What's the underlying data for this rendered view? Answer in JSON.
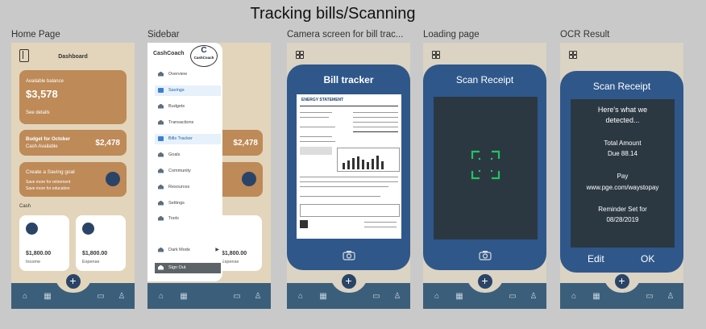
{
  "canvas_title": "Tracking bills/Scanning",
  "screen_labels": [
    "Home Page",
    "Sidebar",
    "Camera screen for bill trac...",
    "Loading page",
    "OCR Result"
  ],
  "home": {
    "title": "Dashboard",
    "balance_label": "Available balance",
    "balance_value": "$3,578",
    "see_details": "See details",
    "budget_title": "Budget for October",
    "budget_sub": "Cash Available",
    "budget_value": "$2,478",
    "saving_title": "Create a Saving goal",
    "saving_line1": "Save more for retirement",
    "saving_line2": "Save more for education",
    "cash_label": "Cash",
    "income_value": "$1,800.00",
    "income_label": "Income",
    "expense_value": "$1,800.00",
    "expense_label": "Expense"
  },
  "sidebar": {
    "brand": "CashCoach",
    "logo_text": "CashCoach",
    "items": [
      {
        "label": "Overview"
      },
      {
        "label": "Savings"
      },
      {
        "label": "Budgets"
      },
      {
        "label": "Transactions"
      },
      {
        "label": "Bills Tracker"
      },
      {
        "label": "Goals"
      },
      {
        "label": "Community"
      },
      {
        "label": "Resources"
      },
      {
        "label": "Settings"
      },
      {
        "label": "Tools"
      }
    ],
    "dark_mode": "Dark Mode",
    "sign_out": "Sign Out",
    "behind_value": "$2,478",
    "behind_expense": "$1,800.00",
    "behind_expense_label": "Expense"
  },
  "camera": {
    "header": "Bill tracker",
    "bill_title": "ENERGY STATEMENT"
  },
  "loading": {
    "header": "Scan Receipt"
  },
  "ocr": {
    "header": "Scan Receipt",
    "line1": "Here's what we",
    "line2": "detected...",
    "total_label": "Total Amount",
    "due": "Due 88.14",
    "pay": "Pay",
    "url": "www.pge.com/waystopay",
    "reminder": "Reminder Set for",
    "date": "08/28/2019",
    "edit": "Edit",
    "ok": "OK"
  },
  "colors": {
    "card_brown": "#bd8a58",
    "navy": "#2a4468",
    "phone_blue": "#2f578a",
    "bar_blue": "#3b5f7b",
    "beige": "#e3d5bb",
    "scan_green": "#22c55e"
  }
}
